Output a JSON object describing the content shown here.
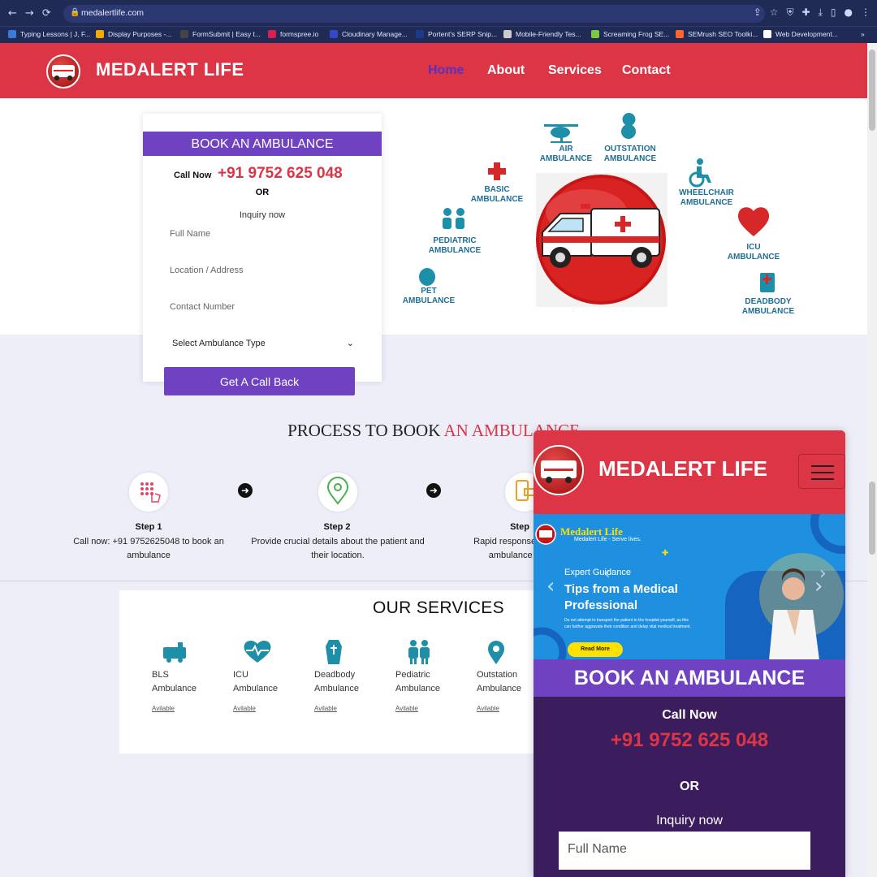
{
  "browser": {
    "url": "medalertlife.com",
    "bookmarks": [
      {
        "label": "Typing Lessons | J, F...",
        "color": "#3a7bd5"
      },
      {
        "label": "Display Purposes -...",
        "color": "#f2a900"
      },
      {
        "label": "FormSubmit | Easy t...",
        "color": "#444444"
      },
      {
        "label": "formspree.io",
        "color": "#d6204e"
      },
      {
        "label": "Cloudinary Manage...",
        "color": "#3448c5"
      },
      {
        "label": "Portent's SERP Snip...",
        "color": "#1b3a8a"
      },
      {
        "label": "Mobile-Friendly Tes...",
        "color": "#cccccc"
      },
      {
        "label": "Screaming Frog SE...",
        "color": "#7ac943"
      },
      {
        "label": "SEMrush SEO Toolki...",
        "color": "#ff642d"
      },
      {
        "label": "Web Development...",
        "color": "#ffffff"
      }
    ]
  },
  "header": {
    "brand": "MEDALERT LIFE",
    "nav": [
      "Home",
      "About",
      "Services",
      "Contact"
    ]
  },
  "booking": {
    "title": "BOOK AN AMBULANCE",
    "call_now": "Call Now",
    "phone": "+91 9752 625 048",
    "or": "OR",
    "inquiry": "Inquiry now",
    "placeholders": [
      "Full Name",
      "Location / Address",
      "Contact Number"
    ],
    "select": "Select Ambulance Type",
    "submit": "Get A Call Back"
  },
  "hero_services": [
    {
      "line1": "AIR",
      "line2": "AMBULANCE"
    },
    {
      "line1": "OUTSTATION",
      "line2": "AMBULANCE"
    },
    {
      "line1": "BASIC",
      "line2": "AMBULANCE"
    },
    {
      "line1": "WHEELCHAIR",
      "line2": "AMBULANCE"
    },
    {
      "line1": "PEDIATRIC",
      "line2": "AMBULANCE"
    },
    {
      "line1": "ICU",
      "line2": "AMBULANCE"
    },
    {
      "line1": "PET",
      "line2": "AMBULANCE"
    },
    {
      "line1": "DEADBODY",
      "line2": "AMBULANCE"
    }
  ],
  "process": {
    "title_black": "PROCESS TO BOOK ",
    "title_red": "AN AMBULANCE",
    "steps": [
      {
        "title": "Step 1",
        "line1": "Call now: +91 9752625048 to book an",
        "line2": "ambulance"
      },
      {
        "title": "Step 2",
        "line1": "Provide crucial details about the patient and",
        "line2": "their location."
      },
      {
        "title": "Step",
        "line1": "Rapid response! Our te",
        "line2": "ambulance with"
      }
    ]
  },
  "services": {
    "title": "OUR SERVICES",
    "items": [
      {
        "line1": "BLS",
        "line2": "Ambulance",
        "status": "Avilable"
      },
      {
        "line1": "ICU",
        "line2": "Ambulance",
        "status": "Avilable"
      },
      {
        "line1": "Deadbody",
        "line2": "Ambulance",
        "status": "Avilable"
      },
      {
        "line1": "Pediatric",
        "line2": "Ambulance",
        "status": "Avilable"
      },
      {
        "line1": "Outstation",
        "line2": "Ambulance",
        "status": "Avilable"
      }
    ]
  },
  "mobile": {
    "brand": "MEDALERT LIFE",
    "banner": {
      "logo_title": "Medalert Life",
      "logo_tagline": "Medalert Life - Serve lives.",
      "eyebrow": "Expert Guidance",
      "heading1": "Tips from a Medical",
      "heading2": "Professional",
      "body1": "Do not attempt to transport the patient to the hospital yourself, as this",
      "body2": "can further aggravate their condition and delay vital medical treatment.",
      "cta": "Read More"
    },
    "book_title": "BOOK AN AMBULANCE",
    "call_now": "Call Now",
    "phone": "+91 9752 625 048",
    "or": "OR",
    "inquiry": "Inquiry now",
    "placeholder": "Full Name"
  },
  "colors": {
    "brand_red": "#dc3545",
    "brand_purple": "#6f42c1",
    "teal": "#1e8fa8"
  }
}
